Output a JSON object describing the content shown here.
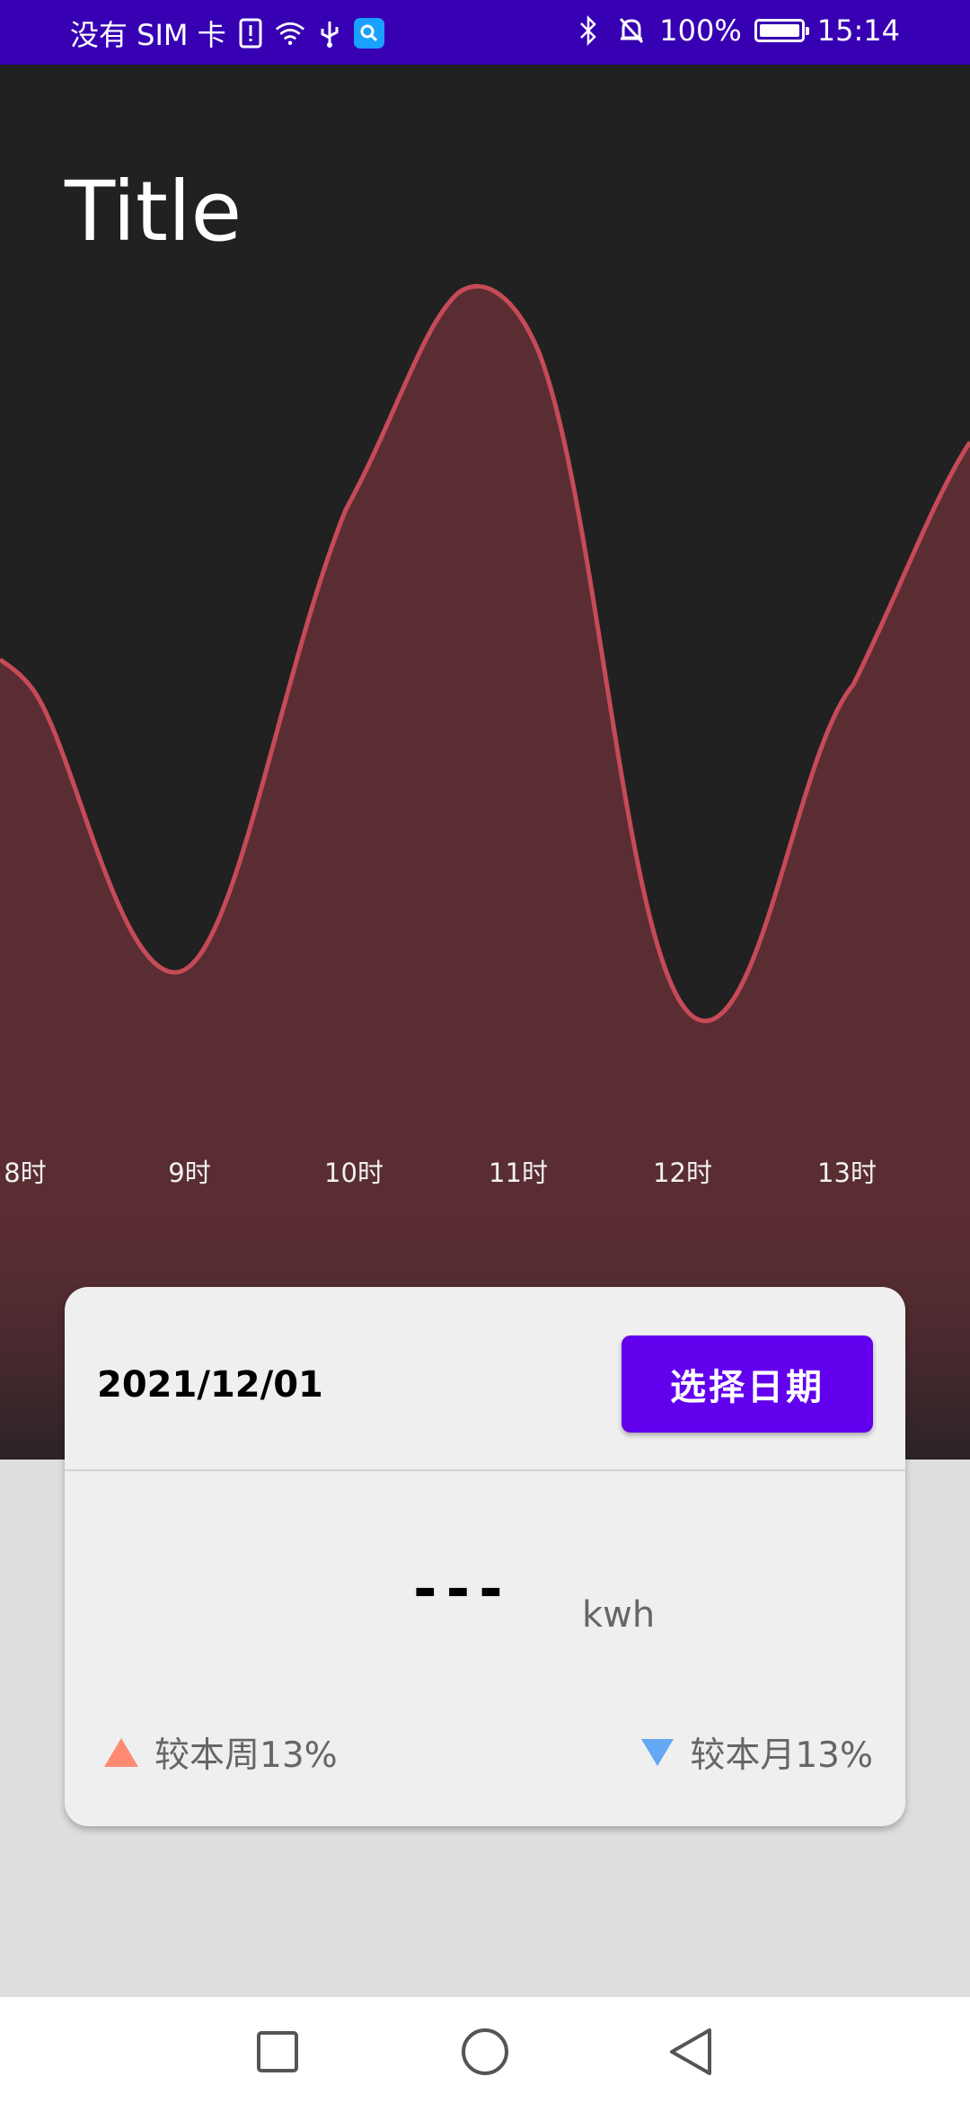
{
  "status_bar": {
    "carrier": "没有 SIM 卡",
    "battery_percent": "100%",
    "time": "15:14",
    "icons": [
      "sim-alert-icon",
      "wifi-icon",
      "usb-icon",
      "search-app-icon",
      "bluetooth-icon",
      "mute-icon",
      "battery-icon"
    ]
  },
  "header": {
    "title": "Title"
  },
  "chart_data": {
    "type": "area",
    "categories": [
      "8时",
      "9时",
      "10时",
      "11时",
      "12时",
      "13时"
    ],
    "series_color": "#c64a57",
    "fill_color": "#5a2d33",
    "background": "#212121",
    "grid": false,
    "legend": "none",
    "title": "",
    "xlabel": "",
    "ylabel": ""
  },
  "card": {
    "date": "2021/12/01",
    "select_date_label": "选择日期",
    "value": "---",
    "unit": "kwh",
    "compare_week": "较本周13%",
    "compare_month": "较本月13%",
    "week_trend": "up",
    "month_trend": "down",
    "up_color": "#ff8a72",
    "down_color": "#63a8f3",
    "accent": "#6200ee"
  },
  "nav": {
    "icons": [
      "recents-square-icon",
      "home-circle-icon",
      "back-triangle-icon"
    ]
  }
}
